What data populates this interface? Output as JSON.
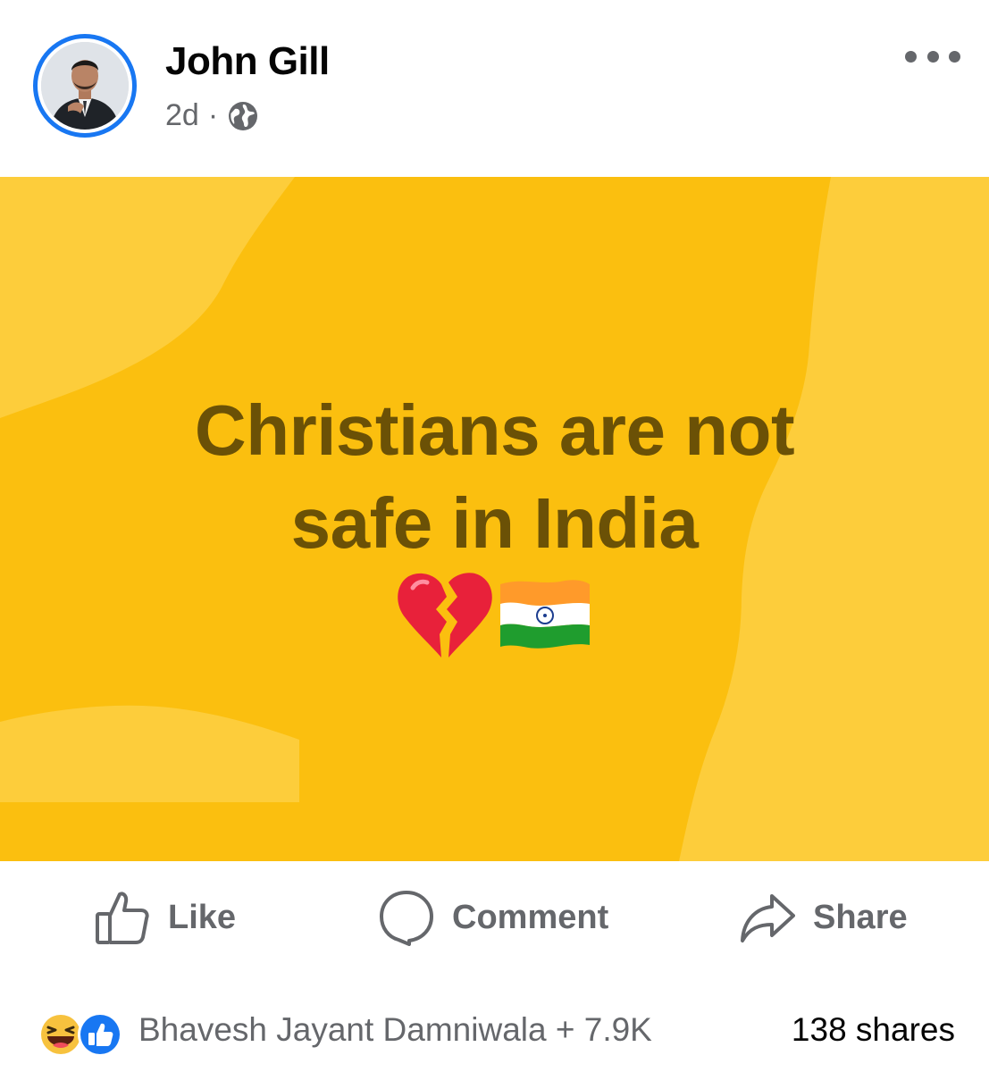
{
  "post": {
    "author": "John Gill",
    "time": "2d",
    "separator": "·",
    "privacy_icon": "globe-icon",
    "more_icon": "more-horizontal-icon"
  },
  "media": {
    "background_color": "#fbbf0f",
    "text_color": "#6b5106",
    "headline_line1": "Christians are not",
    "headline_line2": "safe in India",
    "emojis": [
      "broken-heart-icon",
      "india-flag-icon"
    ]
  },
  "actions": {
    "like_label": "Like",
    "comment_label": "Comment",
    "share_label": "Share"
  },
  "footer": {
    "reaction_icons": [
      "haha-icon",
      "like-reaction-icon"
    ],
    "reactors_text": "Bhavesh Jayant Damniwala + 7.9K",
    "shares_text": "138 shares"
  },
  "colors": {
    "accent": "#1877f2",
    "secondary_text": "#65676b",
    "primary_text": "#050505"
  }
}
